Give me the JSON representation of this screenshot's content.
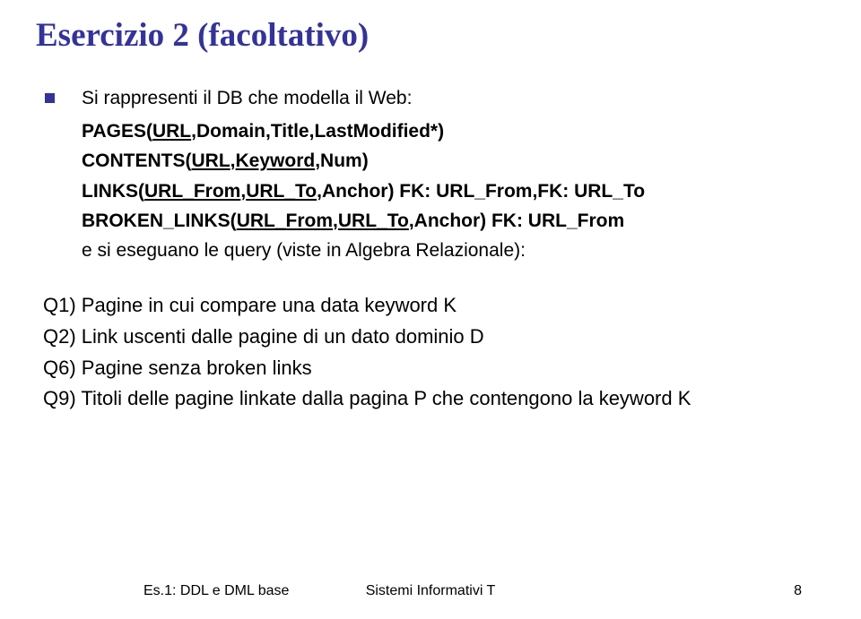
{
  "title": "Esercizio 2 (facoltativo)",
  "intro": "Si rappresenti il DB che modella il Web:",
  "schema": {
    "line1_prefix": "PAGES(",
    "line1_u1": "URL",
    "line1_rest": ",Domain,Title,LastModified*)",
    "line2_prefix": "CONTENTS(",
    "line2_u1": "URL",
    "line2_sep1": ",",
    "line2_u2": "Keyword",
    "line2_rest": ",Num)",
    "line3_prefix": "LINKS(",
    "line3_u1": "URL_From",
    "line3_sep1": ",",
    "line3_u2": "URL_To",
    "line3_rest": ",Anchor) FK: URL_From,FK: URL_To",
    "line4_prefix": "BROKEN_LINKS(",
    "line4_u1": "URL_From",
    "line4_sep1": ",",
    "line4_u2": "URL_To",
    "line4_rest": ",Anchor) FK: URL_From"
  },
  "closing": "e si eseguano le query (viste in Algebra Relazionale):",
  "questions": {
    "q1": "Q1) Pagine in cui compare una data keyword K",
    "q2": "Q2) Link uscenti dalle pagine di un dato dominio D",
    "q6": "Q6) Pagine senza broken links",
    "q9": "Q9) Titoli delle pagine linkate dalla pagina P che contengono la keyword K"
  },
  "footer": {
    "left": "Es.1: DDL e DML base",
    "center": "Sistemi Informativi T",
    "right": "8"
  }
}
